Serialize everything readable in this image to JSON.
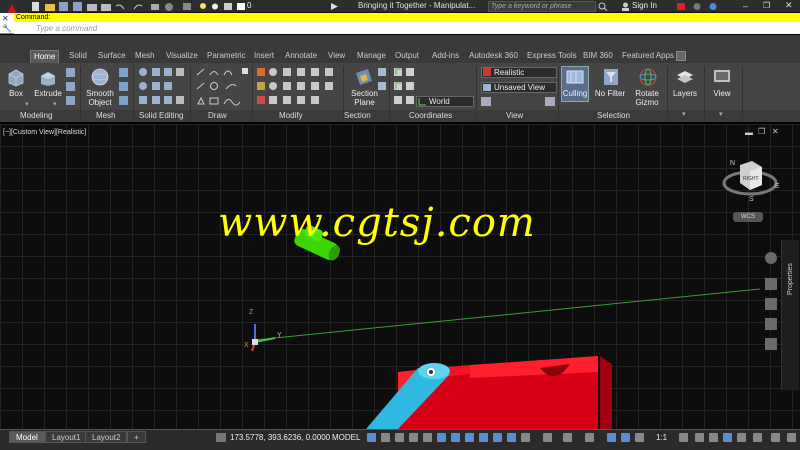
{
  "titlebar": {
    "quick_access_value": "0",
    "document_title": "Bringing it Together - Manipulat...",
    "search_placeholder": "Type a keyword or phrase",
    "signin_label": "Sign In"
  },
  "command": {
    "history_label": "Command:",
    "input_placeholder": "Type a command"
  },
  "tabs": [
    "Home",
    "Solid",
    "Surface",
    "Mesh",
    "Visualize",
    "Parametric",
    "Insert",
    "Annotate",
    "View",
    "Manage",
    "Output",
    "Add-ins",
    "Autodesk 360",
    "Express Tools",
    "BIM 360",
    "Featured Apps"
  ],
  "ribbon": {
    "buttons": {
      "box": "Box",
      "extrude": "Extrude",
      "smooth_object": "Smooth\nObject",
      "section_plane": "Section\nPlane",
      "culling": "Culling",
      "no_filter": "No Filter",
      "rotate_gizmo": "Rotate\nGizmo",
      "layers": "Layers",
      "view": "View"
    },
    "dropdowns": {
      "visual_style": "Realistic",
      "saved_view": "Unsaved View",
      "ucs": "World"
    },
    "panels": [
      "Modeling",
      "Mesh",
      "Solid Editing",
      "Draw",
      "Modify",
      "Section",
      "Coordinates",
      "View",
      "Selection"
    ]
  },
  "viewport": {
    "label": "[−][Custom View][Realistic]",
    "watermark": "www.cgtsj.com",
    "viewcube_face": "RIGHT",
    "compass_letters": [
      "N",
      "E",
      "S"
    ],
    "wcs_label": "WCS",
    "ucs_axes": [
      "Z",
      "Y",
      "X"
    ],
    "properties_label": "Properties"
  },
  "status": {
    "layout_tabs": [
      "Model",
      "Layout1",
      "Layout2"
    ],
    "add_tab": "+",
    "coordinates": "173.5778, 393.6236, 0.0000",
    "space": "MODEL",
    "scale": "1:1"
  },
  "colors": {
    "command_highlight": "#ffff00",
    "watermark": "#ffff00",
    "red_solid": "#e8001a",
    "cyan_solid": "#2fb8e0",
    "green_solid": "#39d600"
  },
  "icons": [
    "autocad-logo-icon",
    "new-icon",
    "open-icon",
    "save-icon",
    "print-icon",
    "undo-icon",
    "redo-icon",
    "search-icon",
    "user-icon",
    "close-icon",
    "viewcube-icon",
    "navigation-bar-icon",
    "properties-icon"
  ]
}
